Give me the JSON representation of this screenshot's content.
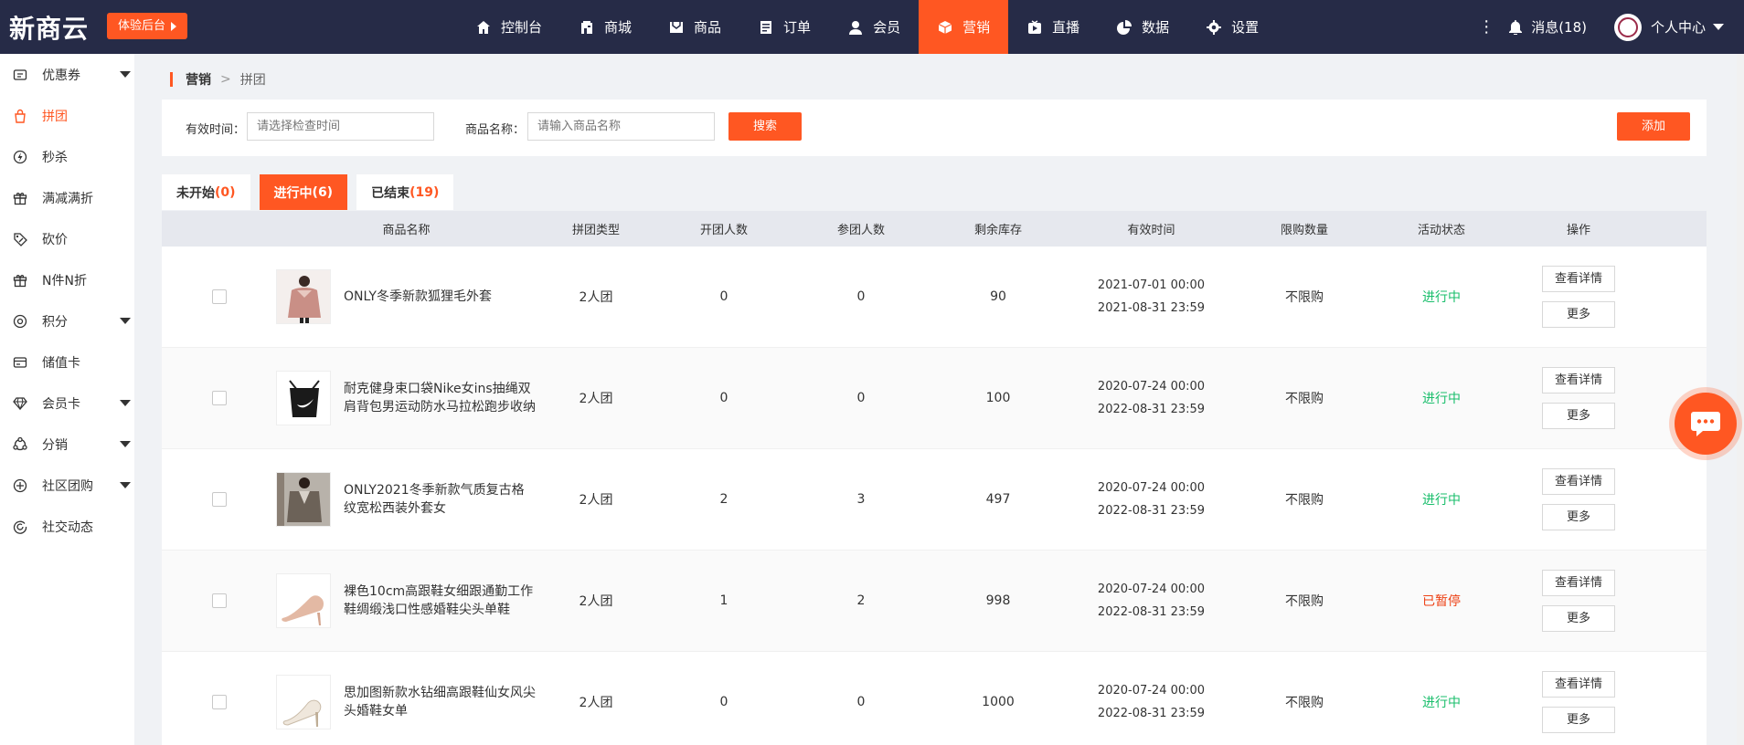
{
  "brand": {
    "logo": "新商云",
    "trial_button": "体验后台"
  },
  "nav": [
    {
      "label": "控制台",
      "icon": "home-icon"
    },
    {
      "label": "商城",
      "icon": "store-icon"
    },
    {
      "label": "商品",
      "icon": "goods-icon"
    },
    {
      "label": "订单",
      "icon": "order-icon"
    },
    {
      "label": "会员",
      "icon": "user-icon"
    },
    {
      "label": "营销",
      "icon": "box-icon",
      "active": true
    },
    {
      "label": "直播",
      "icon": "live-icon"
    },
    {
      "label": "数据",
      "icon": "pie-icon"
    },
    {
      "label": "设置",
      "icon": "gear-icon"
    }
  ],
  "header_right": {
    "messages": "消息(18)",
    "profile": "个人中心"
  },
  "sidebar": [
    {
      "label": "优惠券",
      "icon": "coupon-icon",
      "caret": true
    },
    {
      "label": "拼团",
      "icon": "group-icon",
      "active": true
    },
    {
      "label": "秒杀",
      "icon": "flash-icon"
    },
    {
      "label": "满减满折",
      "icon": "gift-icon"
    },
    {
      "label": "砍价",
      "icon": "tag-icon"
    },
    {
      "label": "N件N折",
      "icon": "gift-icon"
    },
    {
      "label": "积分",
      "icon": "points-icon",
      "caret": true
    },
    {
      "label": "储值卡",
      "icon": "card-icon"
    },
    {
      "label": "会员卡",
      "icon": "diamond-icon",
      "caret": true
    },
    {
      "label": "分销",
      "icon": "share-icon",
      "caret": true
    },
    {
      "label": "社区团购",
      "icon": "community-icon",
      "caret": true
    },
    {
      "label": "社交动态",
      "icon": "social-icon"
    }
  ],
  "breadcrumb": {
    "level1": "营销",
    "separator": ">",
    "level2": "拼团"
  },
  "filter": {
    "time_label": "有效时间：",
    "time_placeholder": "请选择检查时间",
    "name_label": "商品名称：",
    "name_placeholder": "请输入商品名称",
    "search_button": "搜索",
    "add_button": "添加"
  },
  "tabs": [
    {
      "label": "未开始",
      "count": "(0)"
    },
    {
      "label": "进行中",
      "count": "(6)",
      "active": true
    },
    {
      "label": "已结束",
      "count": "(19)"
    }
  ],
  "table": {
    "headers": [
      "商品名称",
      "拼团类型",
      "开团人数",
      "参团人数",
      "剩余库存",
      "有效时间",
      "限购数量",
      "活动状态",
      "操作"
    ],
    "rows": [
      {
        "name": "ONLY冬季新款狐狸毛外套",
        "type": "2人团",
        "open": "0",
        "join": "0",
        "stock": "90",
        "start": "2021-07-01 00:00",
        "end": "2021-08-31 23:59",
        "limit": "不限购",
        "status": "进行中",
        "status_kind": "on",
        "thumb": "coat-pink"
      },
      {
        "name": "耐克健身束口袋Nike女ins抽绳双肩背包男运动防水马拉松跑步收纳",
        "type": "2人团",
        "open": "0",
        "join": "0",
        "stock": "100",
        "start": "2020-07-24 00:00",
        "end": "2022-08-31 23:59",
        "limit": "不限购",
        "status": "进行中",
        "status_kind": "on",
        "thumb": "bag-black"
      },
      {
        "name": "ONLY2021冬季新款气质复古格纹宽松西装外套女",
        "type": "2人团",
        "open": "2",
        "join": "3",
        "stock": "497",
        "start": "2020-07-24 00:00",
        "end": "2022-08-31 23:59",
        "limit": "不限购",
        "status": "进行中",
        "status_kind": "on",
        "thumb": "blazer-grey"
      },
      {
        "name": "裸色10cm高跟鞋女细跟通勤工作鞋绸缎浅口性感婚鞋尖头单鞋",
        "type": "2人团",
        "open": "1",
        "join": "2",
        "stock": "998",
        "start": "2020-07-24 00:00",
        "end": "2022-08-31 23:59",
        "limit": "不限购",
        "status": "已暂停",
        "status_kind": "pause",
        "thumb": "heel-nude"
      },
      {
        "name": "思加图新款水钻细高跟鞋仙女风尖头婚鞋女单",
        "type": "2人团",
        "open": "0",
        "join": "0",
        "stock": "1000",
        "start": "2020-07-24 00:00",
        "end": "2022-08-31 23:59",
        "limit": "不限购",
        "status": "进行中",
        "status_kind": "on",
        "thumb": "heel-clear"
      }
    ],
    "actions": {
      "detail": "查看详情",
      "more": "更多"
    }
  },
  "colors": {
    "accent": "#ff5722",
    "topbar": "#262b47",
    "status_on": "#19be6b",
    "status_pause": "#ed4014"
  }
}
